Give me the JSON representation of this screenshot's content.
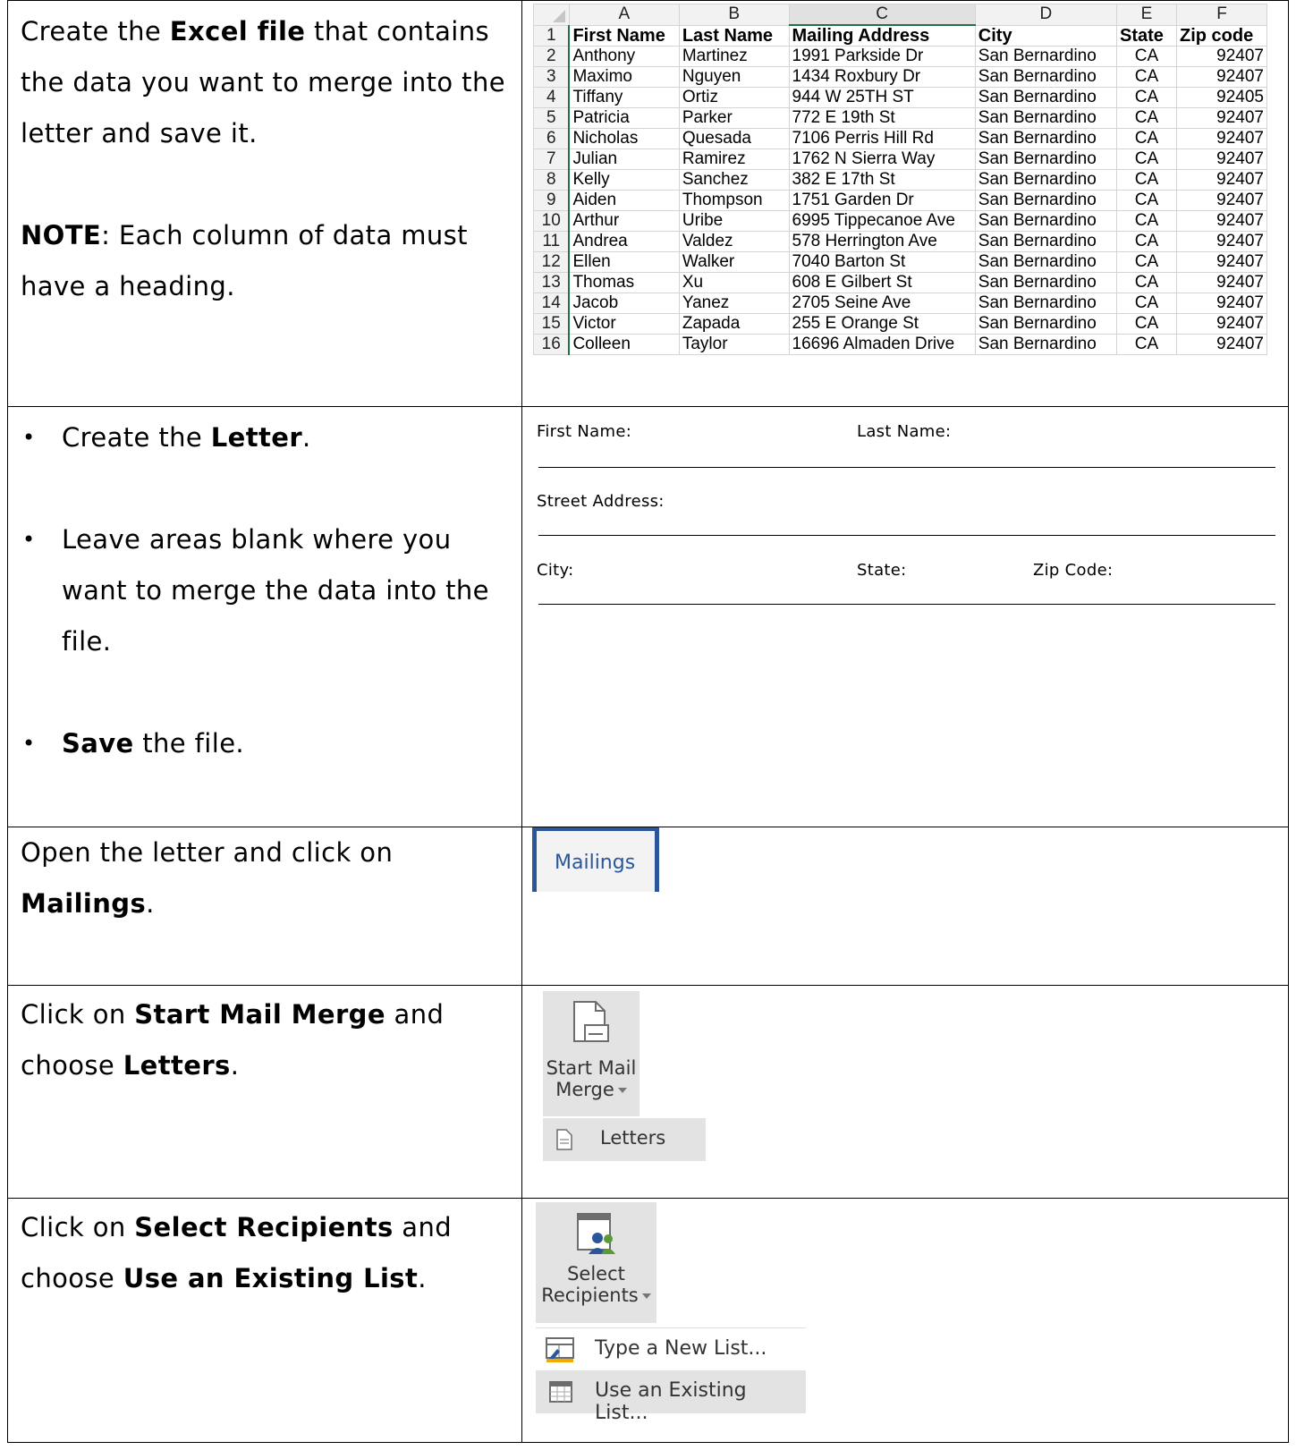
{
  "rows": [
    {
      "left_html_parts": [
        "Create the ",
        "Excel file",
        " that contains the data you want to merge into the letter and save it."
      ],
      "note_label": "NOTE",
      "note_text": ": Each column of data must have a heading."
    },
    {
      "bullets": [
        {
          "pre": "Create the ",
          "bold": "Letter",
          "post": "."
        },
        {
          "pre": "Leave areas blank where you want to merge the data into the file.",
          "bold": "",
          "post": ""
        },
        {
          "pre": "",
          "bold": "Save",
          "post": " the file."
        }
      ]
    },
    {
      "pre": "Open the letter and click on ",
      "bold": "Mailings",
      "post": "."
    },
    {
      "pre": "Click on ",
      "bold": "Start Mail Merge",
      "mid": " and choose ",
      "bold2": "Letters",
      "post": "."
    },
    {
      "pre": "Click on ",
      "bold": "Select Recipients",
      "mid": " and choose ",
      "bold2": "Use an Existing List",
      "post": "."
    }
  ],
  "excel": {
    "columns": [
      "A",
      "B",
      "C",
      "D",
      "E",
      "F"
    ],
    "headers": [
      "First Name",
      "Last Name",
      "Mailing Address",
      "City",
      "State",
      "Zip code"
    ],
    "rows": [
      [
        "Anthony",
        "Martinez",
        "1991 Parkside Dr",
        "San Bernardino",
        "CA",
        "92407"
      ],
      [
        "Maximo",
        "Nguyen",
        "1434 Roxbury Dr",
        "San Bernardino",
        "CA",
        "92407"
      ],
      [
        "Tiffany",
        "Ortiz",
        "944 W 25TH ST",
        "San Bernardino",
        "CA",
        "92405"
      ],
      [
        "Patricia",
        "Parker",
        "772 E 19th St",
        "San Bernardino",
        "CA",
        "92407"
      ],
      [
        "Nicholas",
        "Quesada",
        "7106 Perris Hill Rd",
        "San Bernardino",
        "CA",
        "92407"
      ],
      [
        "Julian",
        "Ramirez",
        "1762 N Sierra Way",
        "San Bernardino",
        "CA",
        "92407"
      ],
      [
        "Kelly",
        "Sanchez",
        "382 E 17th St",
        "San Bernardino",
        "CA",
        "92407"
      ],
      [
        "Aiden",
        "Thompson",
        "1751 Garden Dr",
        "San Bernardino",
        "CA",
        "92407"
      ],
      [
        "Arthur",
        "Uribe",
        "6995 Tippecanoe Ave",
        "San Bernardino",
        "CA",
        "92407"
      ],
      [
        "Andrea",
        "Valdez",
        "578 Herrington Ave",
        "San Bernardino",
        "CA",
        "92407"
      ],
      [
        "Ellen",
        "Walker",
        "7040 Barton St",
        "San Bernardino",
        "CA",
        "92407"
      ],
      [
        "Thomas",
        "Xu",
        "608 E Gilbert St",
        "San Bernardino",
        "CA",
        "92407"
      ],
      [
        "Jacob",
        "Yanez",
        "2705 Seine Ave",
        "San Bernardino",
        "CA",
        "92407"
      ],
      [
        "Victor",
        "Zapada",
        "255 E Orange St",
        "San Bernardino",
        "CA",
        "92407"
      ],
      [
        "Colleen",
        "Taylor",
        "16696 Almaden Drive",
        "San Bernardino",
        "CA",
        "92407"
      ]
    ]
  },
  "letter_form": {
    "first_name": "First Name:",
    "last_name": "Last Name:",
    "street_address": "Street Address:",
    "city": "City:",
    "state": "State:",
    "zip": "Zip Code:"
  },
  "ribbon": {
    "mailings_tab": "Mailings",
    "start_mail_merge_line1": "Start Mail",
    "start_mail_merge_line2": "Merge",
    "letters_item": "Letters",
    "select_recipients_line1": "Select",
    "select_recipients_line2": "Recipients",
    "type_new_list": "Type a New List...",
    "use_existing_list": "Use an Existing List..."
  },
  "colors": {
    "excel_accent": "#217346",
    "word_accent": "#2b579a",
    "ribbon_gray": "#e3e3e3"
  }
}
